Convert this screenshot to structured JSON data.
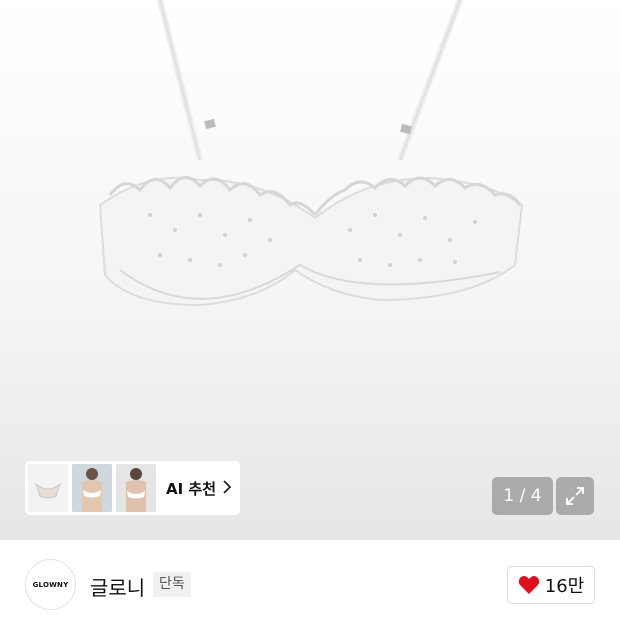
{
  "gallery": {
    "ai_label": "AI 추천",
    "pager": "1 / 4"
  },
  "brand": {
    "logo_text": "GLOWNY",
    "name": "글로니",
    "badge": "단독"
  },
  "like": {
    "count": "16만",
    "color": "#e0101f"
  },
  "icons": [
    "chevron-right-icon",
    "expand-icon",
    "heart-icon"
  ]
}
